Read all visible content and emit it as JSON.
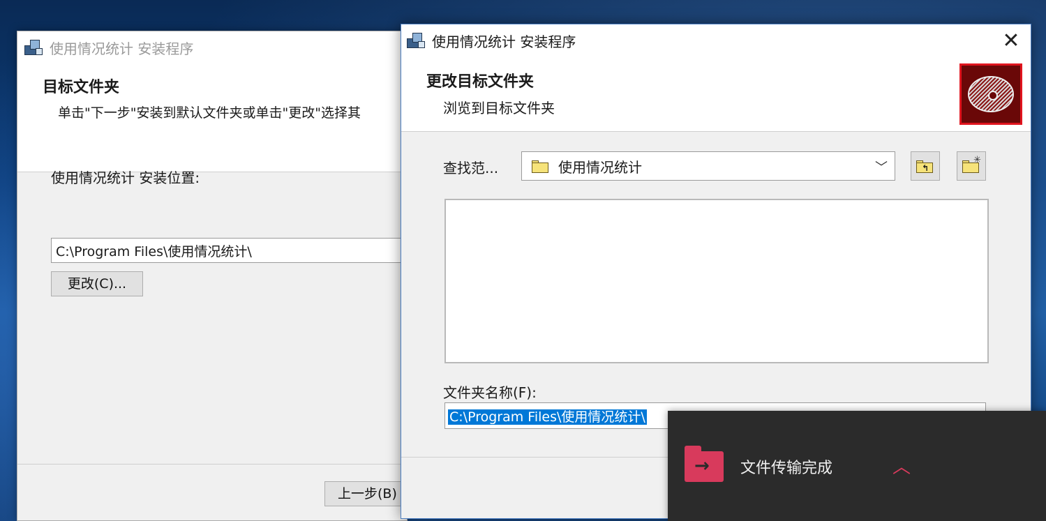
{
  "back_window": {
    "title": "使用情况统计 安装程序",
    "header_title": "目标文件夹",
    "header_subtitle": "单击\"下一步\"安装到默认文件夹或单击\"更改\"选择其",
    "install_location_label": "使用情况统计 安装位置:",
    "install_path": "C:\\Program Files\\使用情况统计\\",
    "change_button": "更改(C)...",
    "back_button": "上一步(B)"
  },
  "front_window": {
    "title": "使用情况统计 安装程序",
    "close_glyph": "✕",
    "header_title": "更改目标文件夹",
    "header_subtitle": "浏览到目标文件夹",
    "look_in_label": "查找范...",
    "look_in_value": "使用情况统计",
    "folder_name_label": "文件夹名称(F):",
    "folder_name_value": "C:\\Program Files\\使用情况统计\\",
    "icons": [
      "app-installer-icon",
      "close-icon",
      "disc-icon",
      "folder-icon",
      "chevron-down-icon",
      "up-folder-icon",
      "new-folder-icon"
    ]
  },
  "toast": {
    "text": "文件传输完成",
    "icon": "folder-arrow-icon",
    "chevron": "chevron-up-icon",
    "accent": "#d83a5c"
  },
  "colors": {
    "selection": "#0078d7",
    "badge_border": "#e0141e"
  }
}
